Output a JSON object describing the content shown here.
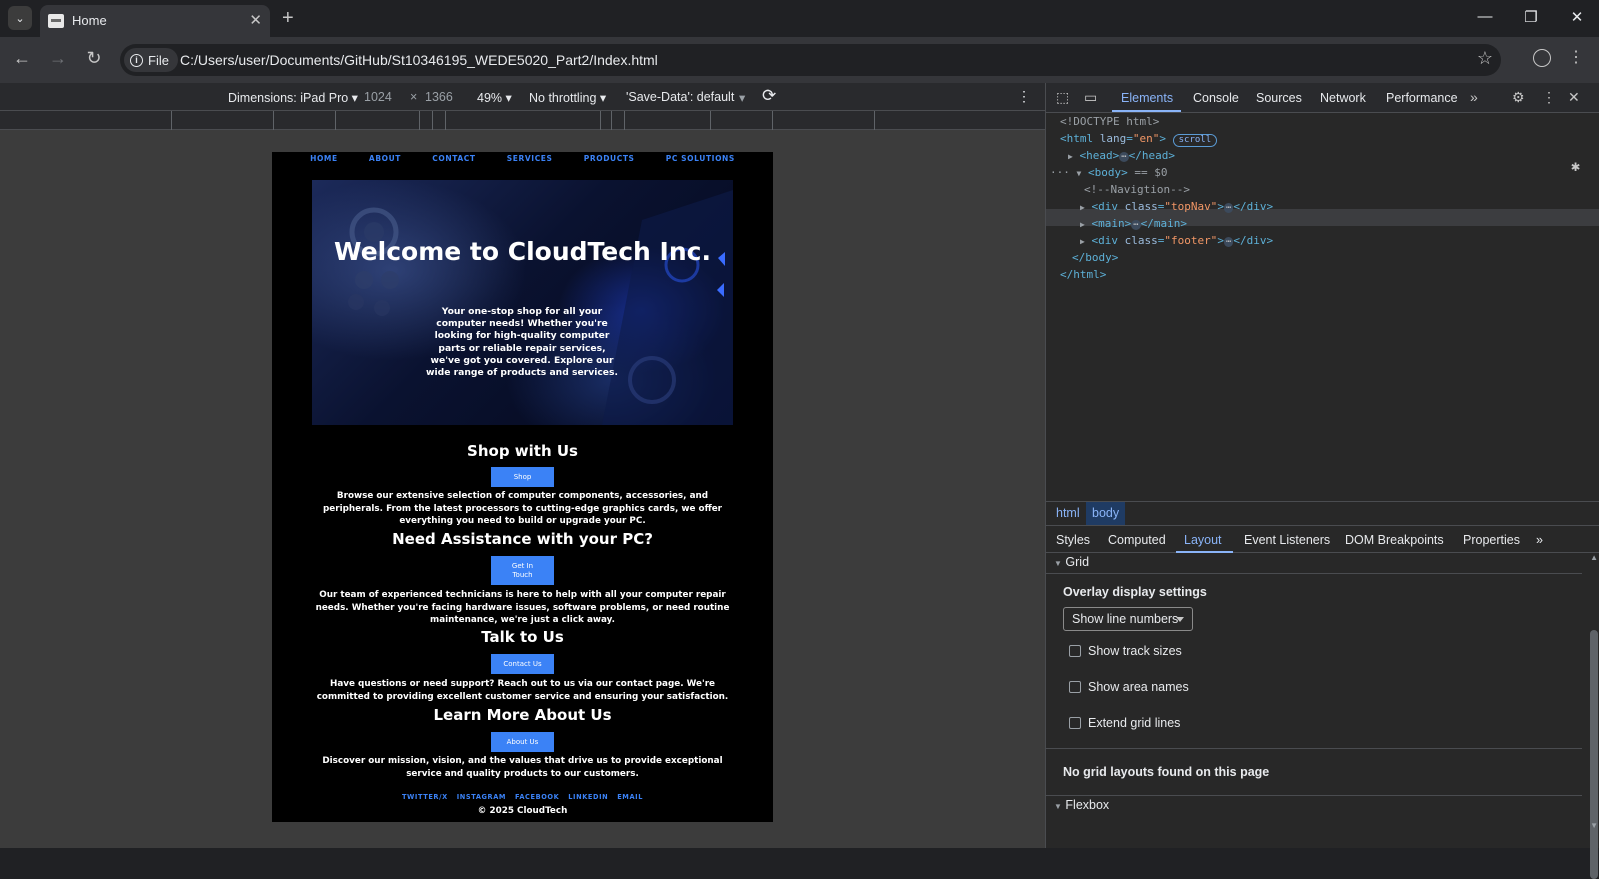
{
  "browser": {
    "tab_title": "Home",
    "url": "C:/Users/user/Documents/GitHub/St10346195_WEDE5020_Part2/Index.html",
    "site_chip": "File"
  },
  "device_toolbar": {
    "dimensions_label": "Dimensions: iPad Pro ▾",
    "width": "1024",
    "times": "×",
    "height": "1366",
    "zoom": "49% ▾",
    "throttling": "No throttling ▾",
    "save_data": "'Save-Data': default"
  },
  "emulated_page": {
    "nav": [
      "HOME",
      "ABOUT",
      "CONTACT",
      "SERVICES",
      "PRODUCTS",
      "PC SOLUTIONS"
    ],
    "hero_title": "Welcome to CloudTech Inc.",
    "hero_text": "Your one-stop shop for all your computer needs! Whether you're looking for high-quality computer parts or reliable repair services, we've got you covered. Explore our wide range of products and services.",
    "sections": [
      {
        "heading": "Shop with Us",
        "button": "Shop",
        "text": "Browse our extensive selection of computer components, accessories, and peripherals. From the latest processors to cutting-edge graphics cards, we offer everything you need to build or upgrade your PC."
      },
      {
        "heading": "Need Assistance with your PC?",
        "button": "Get In Touch",
        "text": "Our team of experienced technicians is here to help with all your computer repair needs. Whether you're facing hardware issues, software problems, or need routine maintenance, we're just a click away."
      },
      {
        "heading": "Talk to Us",
        "button": "Contact Us",
        "text": "Have questions or need support? Reach out to us via our contact page. We're committed to providing excellent customer service and ensuring your satisfaction."
      },
      {
        "heading": "Learn More About Us",
        "button": "About Us",
        "text": "Discover our mission, vision, and the values that drive us to provide exceptional service and quality products to our customers."
      }
    ],
    "footer_links": [
      "TWITTER/X",
      "INSTAGRAM",
      "FACEBOOK",
      "LINKEDIN",
      "EMAIL"
    ],
    "copyright": "© 2025 CloudTech"
  },
  "devtools": {
    "tabs": [
      "Elements",
      "Console",
      "Sources",
      "Network",
      "Performance"
    ],
    "active_tab": "Elements",
    "dom": {
      "doctype": "<!DOCTYPE html>",
      "html_open": "<html",
      "html_attr": "lang",
      "html_val": "\"en\"",
      "html_close": ">",
      "scroll_badge": "scroll",
      "head": "<head>",
      "head_close": "</head>",
      "body": "<body>",
      "body_marker": " == $0",
      "comment": "<!--Navigtion-->",
      "div_open": "<div",
      "class_attr": "class",
      "topnav_val": "\"topNav\"",
      "gt": ">",
      "div_close": "</div>",
      "main": "<main>",
      "main_close": "</main>",
      "footer_val": "\"footer\"",
      "body_close": "</body>",
      "html_end": "</html>",
      "ellipsis": "⋯"
    },
    "breadcrumbs": [
      "html",
      "body"
    ],
    "sub_tabs": [
      "Styles",
      "Computed",
      "Layout",
      "Event Listeners",
      "DOM Breakpoints",
      "Properties"
    ],
    "active_sub_tab": "Layout",
    "layout": {
      "grid_label": "Grid",
      "overlay_title": "Overlay display settings",
      "select_value": "Show line numbers",
      "checkboxes": [
        "Show track sizes",
        "Show area names",
        "Extend grid lines"
      ],
      "no_grid": "No grid layouts found on this page",
      "flexbox_label": "Flexbox"
    }
  },
  "colors": {
    "accent": "#3b82f6",
    "devtools_link": "#8ab4f8",
    "attr_value": "#f29766"
  }
}
